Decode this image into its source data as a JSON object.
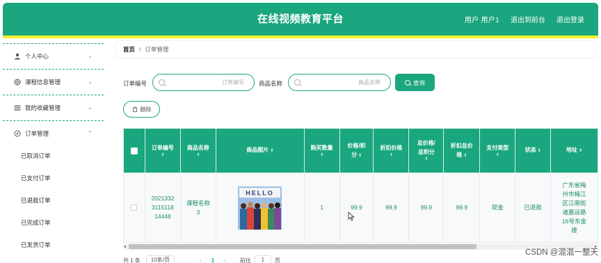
{
  "header": {
    "title": "在线视频教育平台",
    "nav": {
      "user": "用户 用户1",
      "back_front": "退出到前台",
      "logout": "退出登录"
    }
  },
  "sidebar": {
    "items": [
      {
        "label": "个人中心",
        "icon": "user-icon",
        "chevron": "⌄"
      },
      {
        "label": "课程信息管理",
        "icon": "aperture-icon",
        "chevron": "⌄"
      },
      {
        "label": "我的收藏管理",
        "icon": "list-icon",
        "chevron": "⌄"
      },
      {
        "label": "订单管理",
        "icon": "compass-icon",
        "chevron": "⌃"
      }
    ],
    "sub_items": [
      {
        "label": "已取消订单"
      },
      {
        "label": "已支付订单"
      },
      {
        "label": "已退款订单"
      },
      {
        "label": "已完成订单"
      },
      {
        "label": "已发货订单"
      }
    ]
  },
  "breadcrumb": {
    "home": "首页",
    "separator": "/",
    "current": "订单管理"
  },
  "search": {
    "order_no_label": "订单编号",
    "order_no_placeholder": "订单编号",
    "product_name_label": "商品名称",
    "product_name_placeholder": "商品名称",
    "query_label": "查询"
  },
  "actions": {
    "delete_label": "删除"
  },
  "table": {
    "sort_glyph": "⇕",
    "columns": [
      {
        "label1": "订单编号",
        "label2": ""
      },
      {
        "label1": "商品名称",
        "label2": ""
      },
      {
        "label1": "商品图片",
        "label2": ""
      },
      {
        "label1": "购买数量",
        "label2": ""
      },
      {
        "label1": "价格/积",
        "label2": "分"
      },
      {
        "label1": "折扣价格",
        "label2": ""
      },
      {
        "label1": "总价格/",
        "label2": "总积分"
      },
      {
        "label1": "折扣总价",
        "label2": "格"
      },
      {
        "label1": "支付类型",
        "label2": ""
      },
      {
        "label1": "状态",
        "label2": ""
      },
      {
        "label1": "地址",
        "label2": ""
      }
    ],
    "rows": [
      {
        "order_no_l1": "2021332",
        "order_no_l2": "3115118",
        "order_no_l3": "14448",
        "product_name_l1": "课程名称",
        "product_name_l2": "3",
        "image_text": "HELLO",
        "quantity": "1",
        "price": "99.9",
        "discount_price": "99.9",
        "total_price": "99.9",
        "discount_total": "99.9",
        "pay_type": "现金",
        "status": "已退款",
        "address_l1": "广东省梅",
        "address_l2": "州市梅江",
        "address_l3": "区江南街",
        "address_l4": "道嘉运路",
        "address_l5": "16号东金",
        "address_l6": "楼"
      }
    ]
  },
  "scrollbar": {
    "left_arrow": "◂",
    "right_arrow": "▸"
  },
  "pagination": {
    "total": "共 1 条",
    "page_size": "10条/页",
    "prev": "‹",
    "current": "1",
    "next": "›",
    "goto_label": "前往",
    "goto_value": "1",
    "page_suffix": "页"
  },
  "watermark": "CSDN @混混一整天",
  "colors": {
    "primary": "#1aa67e",
    "accent_strip": "#f5ef2f"
  }
}
